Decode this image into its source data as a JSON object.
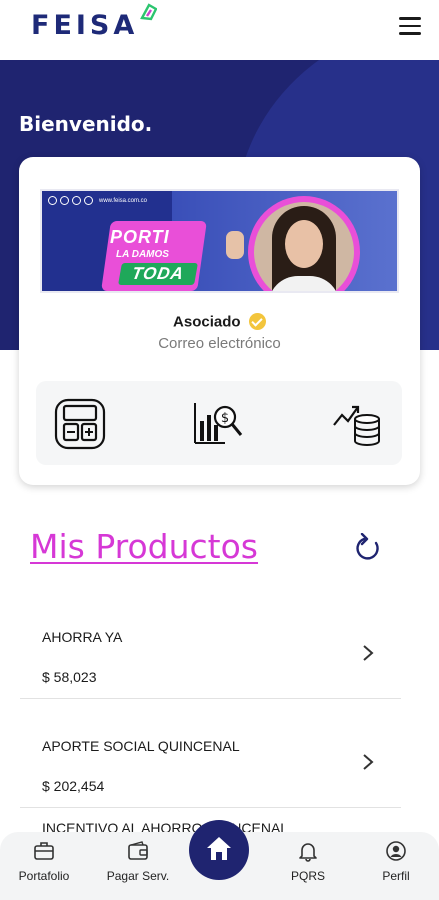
{
  "header": {
    "logo_text": "FEISA",
    "menu_icon": "hamburger-menu-icon"
  },
  "hero": {
    "welcome": "Bienvenido."
  },
  "card": {
    "banner": {
      "url": "www.feisa.com.co",
      "line1": "PORTI",
      "line2": "LA DAMOS",
      "line3": "TODA"
    },
    "role": "Asociado",
    "email": "Correo electrónico",
    "quick_actions": [
      {
        "icon": "calculator-icon"
      },
      {
        "icon": "financial-analysis-icon"
      },
      {
        "icon": "savings-growth-icon"
      }
    ]
  },
  "products": {
    "title": "Mis Productos",
    "items": [
      {
        "name": "AHORRA YA",
        "value": "$ 58,023"
      },
      {
        "name": "APORTE SOCIAL QUINCENAL",
        "value": "$ 202,454"
      }
    ],
    "peek_item": "INCENTIVO AL AHORRO QUINCENAL"
  },
  "bottom_nav": {
    "items": [
      {
        "label": "Portafolio",
        "icon": "briefcase-icon"
      },
      {
        "label": "Pagar Serv.",
        "icon": "wallet-icon"
      },
      {
        "label": "",
        "icon": "home-icon"
      },
      {
        "label": "PQRS",
        "icon": "bell-icon"
      },
      {
        "label": "Perfil",
        "icon": "user-circle-icon"
      }
    ]
  },
  "colors": {
    "brand_navy": "#1f2470",
    "accent_pink": "#d638d6",
    "verified_yellow": "#f3c53c"
  }
}
